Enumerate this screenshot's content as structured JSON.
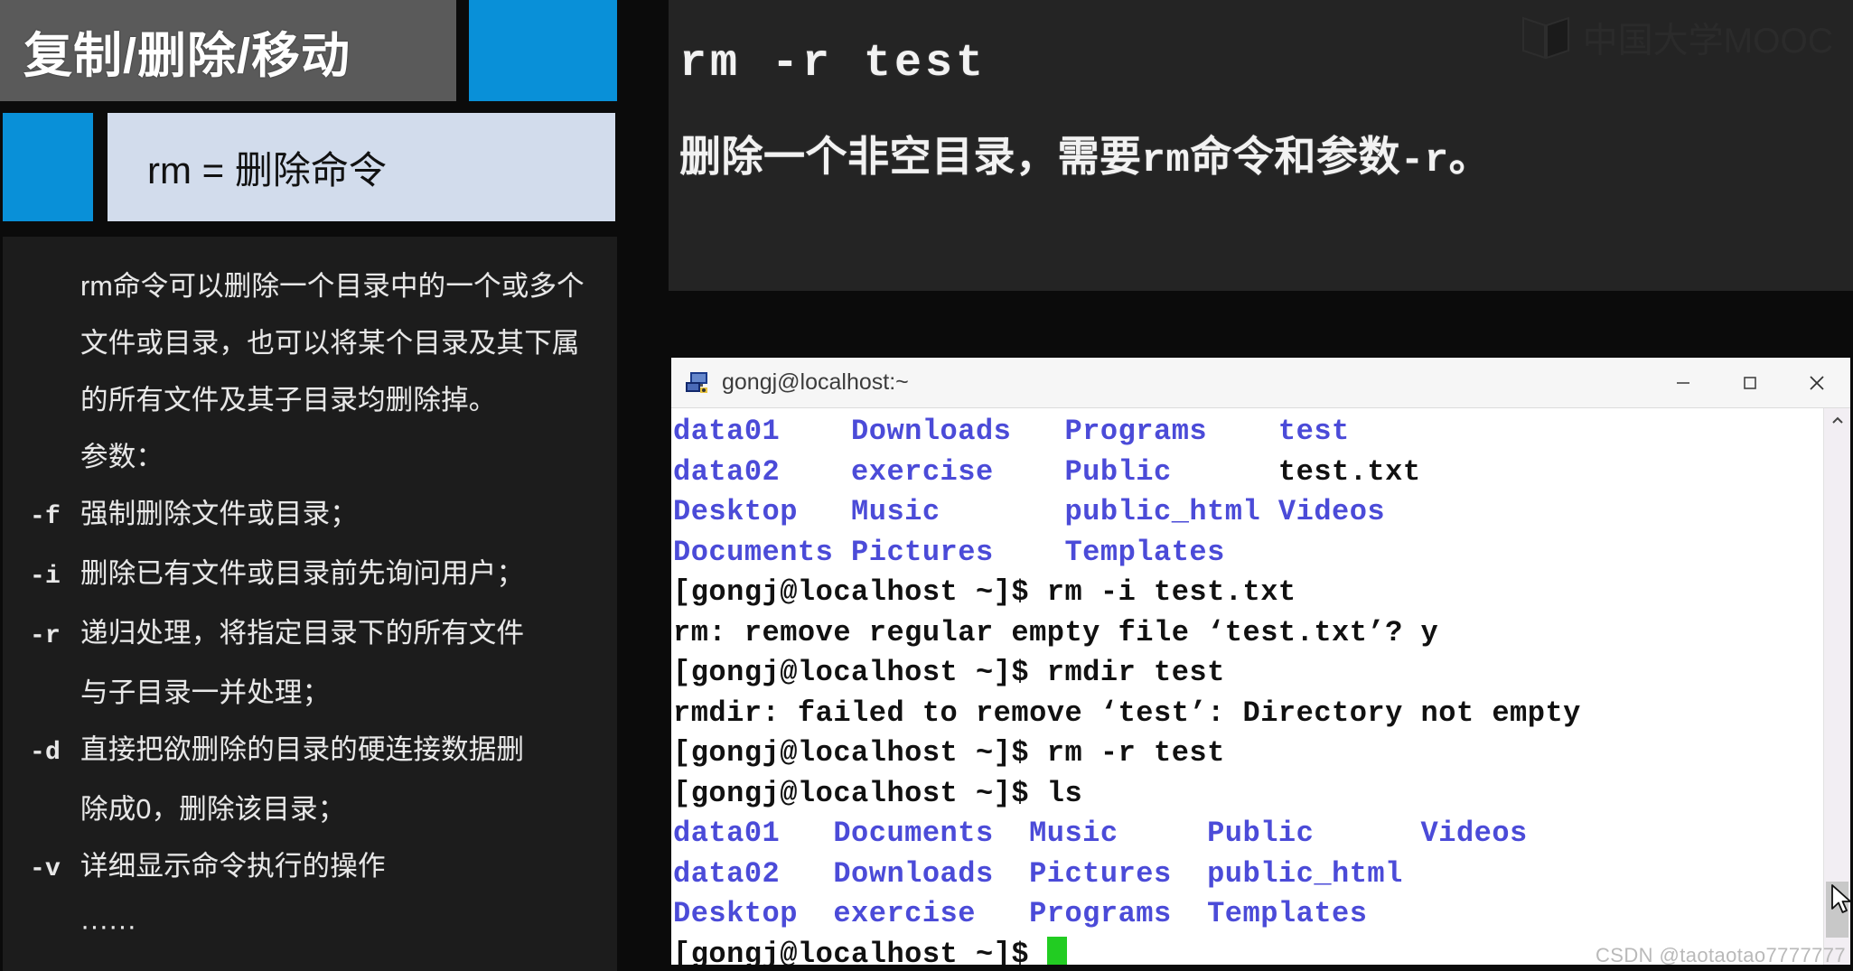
{
  "slide": {
    "title": "复制/删除/移动",
    "definition_label": "rm = 删除命令",
    "accent_color": "#0990d8",
    "title_bar_color": "#5a5a5a",
    "definition_box_color": "#d2dcec",
    "body_lines": [
      {
        "flag": "",
        "text": "rm命令可以删除一个目录中的一个或多个"
      },
      {
        "flag": "",
        "text": "文件或目录，也可以将某个目录及其下属"
      },
      {
        "flag": "",
        "text": "的所有文件及其子目录均删除掉。"
      },
      {
        "flag": "",
        "text": "参数："
      },
      {
        "flag": "-f",
        "text": "强制删除文件或目录；"
      },
      {
        "flag": "-i",
        "text": "删除已有文件或目录前先询问用户；"
      },
      {
        "flag": "-r",
        "text": "递归处理，将指定目录下的所有文件"
      },
      {
        "flag": "",
        "text": "与子目录一并处理；"
      },
      {
        "flag": "-d",
        "text": "直接把欲删除的目录的硬连接数据删"
      },
      {
        "flag": "",
        "text": "除成0，删除该目录；"
      },
      {
        "flag": "-v",
        "text": "详细显示命令执行的操作"
      },
      {
        "flag": "",
        "text": "······"
      }
    ]
  },
  "header": {
    "command": "rm -r test",
    "description_pre": "删除一个非空目录，需要",
    "description_mono1": "rm",
    "description_mid": "命令和参数",
    "description_mono2": "-r",
    "description_post": "。",
    "logo_text": "中国大学MOOC"
  },
  "terminal": {
    "title": "gongj@localhost:~",
    "icon": "putty-computer-icon",
    "window_buttons": [
      {
        "name": "minimize",
        "glyph": "—"
      },
      {
        "name": "maximize",
        "glyph": "▢"
      },
      {
        "name": "close",
        "glyph": "✕"
      }
    ],
    "prompt": "[gongj@localhost ~]$",
    "dir_color": "#4b4bd8",
    "file_color": "#111111",
    "cursor_color": "#22cc22",
    "lines": [
      {
        "type": "listing",
        "segments": [
          {
            "text": "data01    ",
            "kind": "dir"
          },
          {
            "text": "Downloads   ",
            "kind": "dir"
          },
          {
            "text": "Programs    ",
            "kind": "dir"
          },
          {
            "text": "test",
            "kind": "dir"
          }
        ]
      },
      {
        "type": "listing",
        "segments": [
          {
            "text": "data02    ",
            "kind": "dir"
          },
          {
            "text": "exercise    ",
            "kind": "dir"
          },
          {
            "text": "Public      ",
            "kind": "dir"
          },
          {
            "text": "test.txt",
            "kind": "file"
          }
        ]
      },
      {
        "type": "listing",
        "segments": [
          {
            "text": "Desktop   ",
            "kind": "dir"
          },
          {
            "text": "Music       ",
            "kind": "dir"
          },
          {
            "text": "public_html ",
            "kind": "dir"
          },
          {
            "text": "Videos",
            "kind": "dir"
          }
        ]
      },
      {
        "type": "listing",
        "segments": [
          {
            "text": "Documents ",
            "kind": "dir"
          },
          {
            "text": "Pictures    ",
            "kind": "dir"
          },
          {
            "text": "Templates",
            "kind": "dir"
          }
        ]
      },
      {
        "type": "command",
        "segments": [
          {
            "text": "[gongj@localhost ~]$ rm -i test.txt",
            "kind": "file"
          }
        ]
      },
      {
        "type": "output",
        "segments": [
          {
            "text": "rm: remove regular empty file ‘test.txt’? y",
            "kind": "file"
          }
        ]
      },
      {
        "type": "command",
        "segments": [
          {
            "text": "[gongj@localhost ~]$ rmdir test",
            "kind": "file"
          }
        ]
      },
      {
        "type": "output",
        "segments": [
          {
            "text": "rmdir: failed to remove ‘test’: Directory not empty",
            "kind": "file"
          }
        ]
      },
      {
        "type": "command",
        "segments": [
          {
            "text": "[gongj@localhost ~]$ rm -r test",
            "kind": "file"
          }
        ]
      },
      {
        "type": "command",
        "segments": [
          {
            "text": "[gongj@localhost ~]$ ls",
            "kind": "file"
          }
        ]
      },
      {
        "type": "listing",
        "segments": [
          {
            "text": "data01   ",
            "kind": "dir"
          },
          {
            "text": "Documents  ",
            "kind": "dir"
          },
          {
            "text": "Music     ",
            "kind": "dir"
          },
          {
            "text": "Public      ",
            "kind": "dir"
          },
          {
            "text": "Videos",
            "kind": "dir"
          }
        ]
      },
      {
        "type": "listing",
        "segments": [
          {
            "text": "data02   ",
            "kind": "dir"
          },
          {
            "text": "Downloads  ",
            "kind": "dir"
          },
          {
            "text": "Pictures  ",
            "kind": "dir"
          },
          {
            "text": "public_html",
            "kind": "dir"
          }
        ]
      },
      {
        "type": "listing",
        "segments": [
          {
            "text": "Desktop  ",
            "kind": "dir"
          },
          {
            "text": "exercise   ",
            "kind": "dir"
          },
          {
            "text": "Programs  ",
            "kind": "dir"
          },
          {
            "text": "Templates",
            "kind": "dir"
          }
        ]
      },
      {
        "type": "prompt",
        "segments": [
          {
            "text": "[gongj@localhost ~]$ ",
            "kind": "file"
          }
        ],
        "cursor": true
      }
    ]
  },
  "watermark": {
    "text": "CSDN @taotaotao7777777"
  }
}
